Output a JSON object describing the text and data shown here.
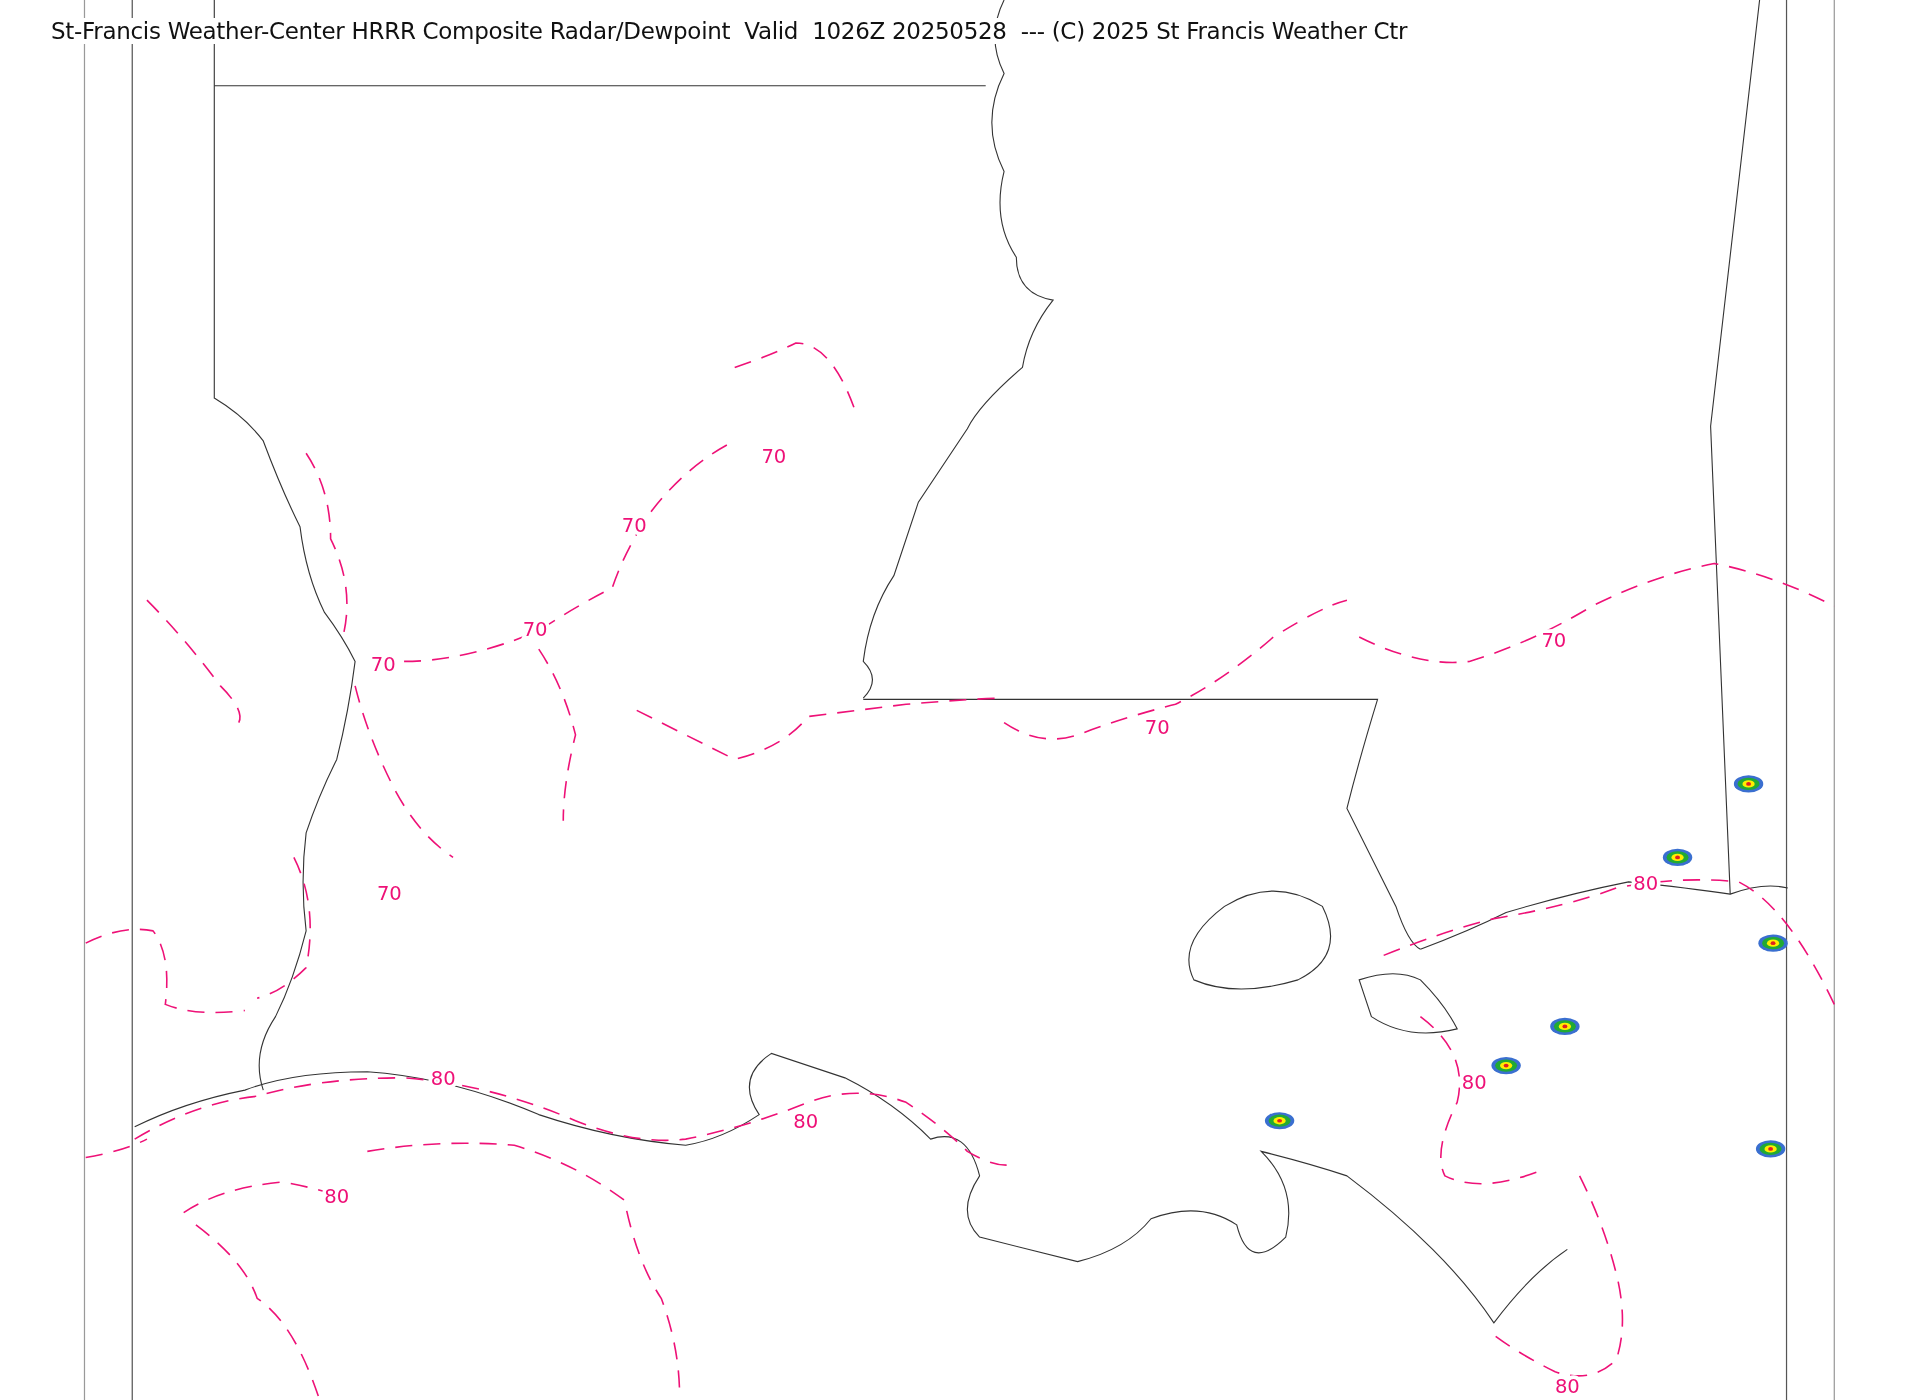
{
  "title": "St-Francis Weather-Center HRRR Composite Radar/Dewpoint  Valid  1026Z 20250528  --- (C) 2025 St Francis Weather Ctr",
  "contour_labels": [
    "70",
    "70",
    "70",
    "70",
    "70",
    "70",
    "70",
    "80",
    "80",
    "80",
    "80",
    "80",
    "80"
  ]
}
